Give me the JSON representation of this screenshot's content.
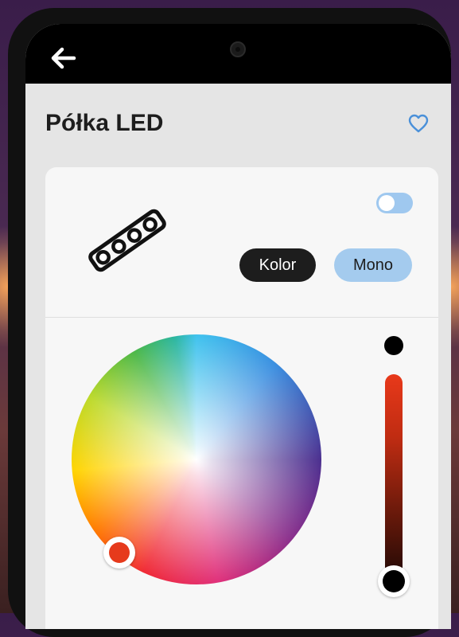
{
  "header": {
    "title": "Półka LED",
    "back_icon": "arrow-left-icon",
    "favorite_icon": "heart-outline-icon"
  },
  "device": {
    "icon": "led-strip-icon",
    "power_on": false
  },
  "modes": {
    "kolor_label": "Kolor",
    "mono_label": "Mono",
    "selected": "Kolor"
  },
  "color": {
    "selected_hex": "#e63a1c",
    "brightness_percent": 0
  },
  "colors": {
    "accent": "#a4cbee",
    "heart": "#4a90d9",
    "dark": "#1d1d1d",
    "background": "#e5e5e5",
    "card": "#f7f7f7"
  }
}
